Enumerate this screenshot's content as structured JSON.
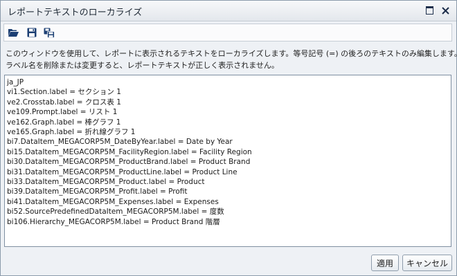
{
  "window": {
    "title": "レポートテキストのローカライズ"
  },
  "toolbar": {
    "open_icon": "folder-open-icon",
    "save_icon": "save-icon",
    "save_as_icon": "save-as-icon"
  },
  "instructions": {
    "line1": "このウィンドウを使用して、レポートに表示されるテキストをローカライズします。等号記号 (=) の後ろのテキストのみ編集します。",
    "line2": "ラベル名を削除または変更すると、レポートテキストが正しく表示されません。"
  },
  "editor": {
    "lines": [
      "ja_JP",
      "vi1.Section.label = セクション 1",
      "ve2.Crosstab.label = クロス表 1",
      "ve109.Prompt.label = リスト 1",
      "ve162.Graph.label = 棒グラフ 1",
      "ve165.Graph.label = 折れ線グラフ 1",
      "bi7.DataItem_MEGACORP5M_DateByYear.label = Date by Year",
      "bi15.DataItem_MEGACORP5M_FacilityRegion.label = Facility Region",
      "bi30.DataItem_MEGACORP5M_ProductBrand.label = Product Brand",
      "bi31.DataItem_MEGACORP5M_ProductLine.label = Product Line",
      "bi33.DataItem_MEGACORP5M_Product.label = Product",
      "bi39.DataItem_MEGACORP5M_Profit.label = Profit",
      "bi41.DataItem_MEGACORP5M_Expenses.label = Expenses",
      "bi52.SourcePredefinedDataItem_MEGACORP5M.label = 度数",
      "bi106.Hierarchy_MEGACORP5M.label = Product Brand 階層"
    ]
  },
  "footer": {
    "apply_label": "適用",
    "cancel_label": "キャンセル"
  },
  "colors": {
    "icon_blue": "#1c3f73",
    "accent_yellow": "#f2c230"
  }
}
